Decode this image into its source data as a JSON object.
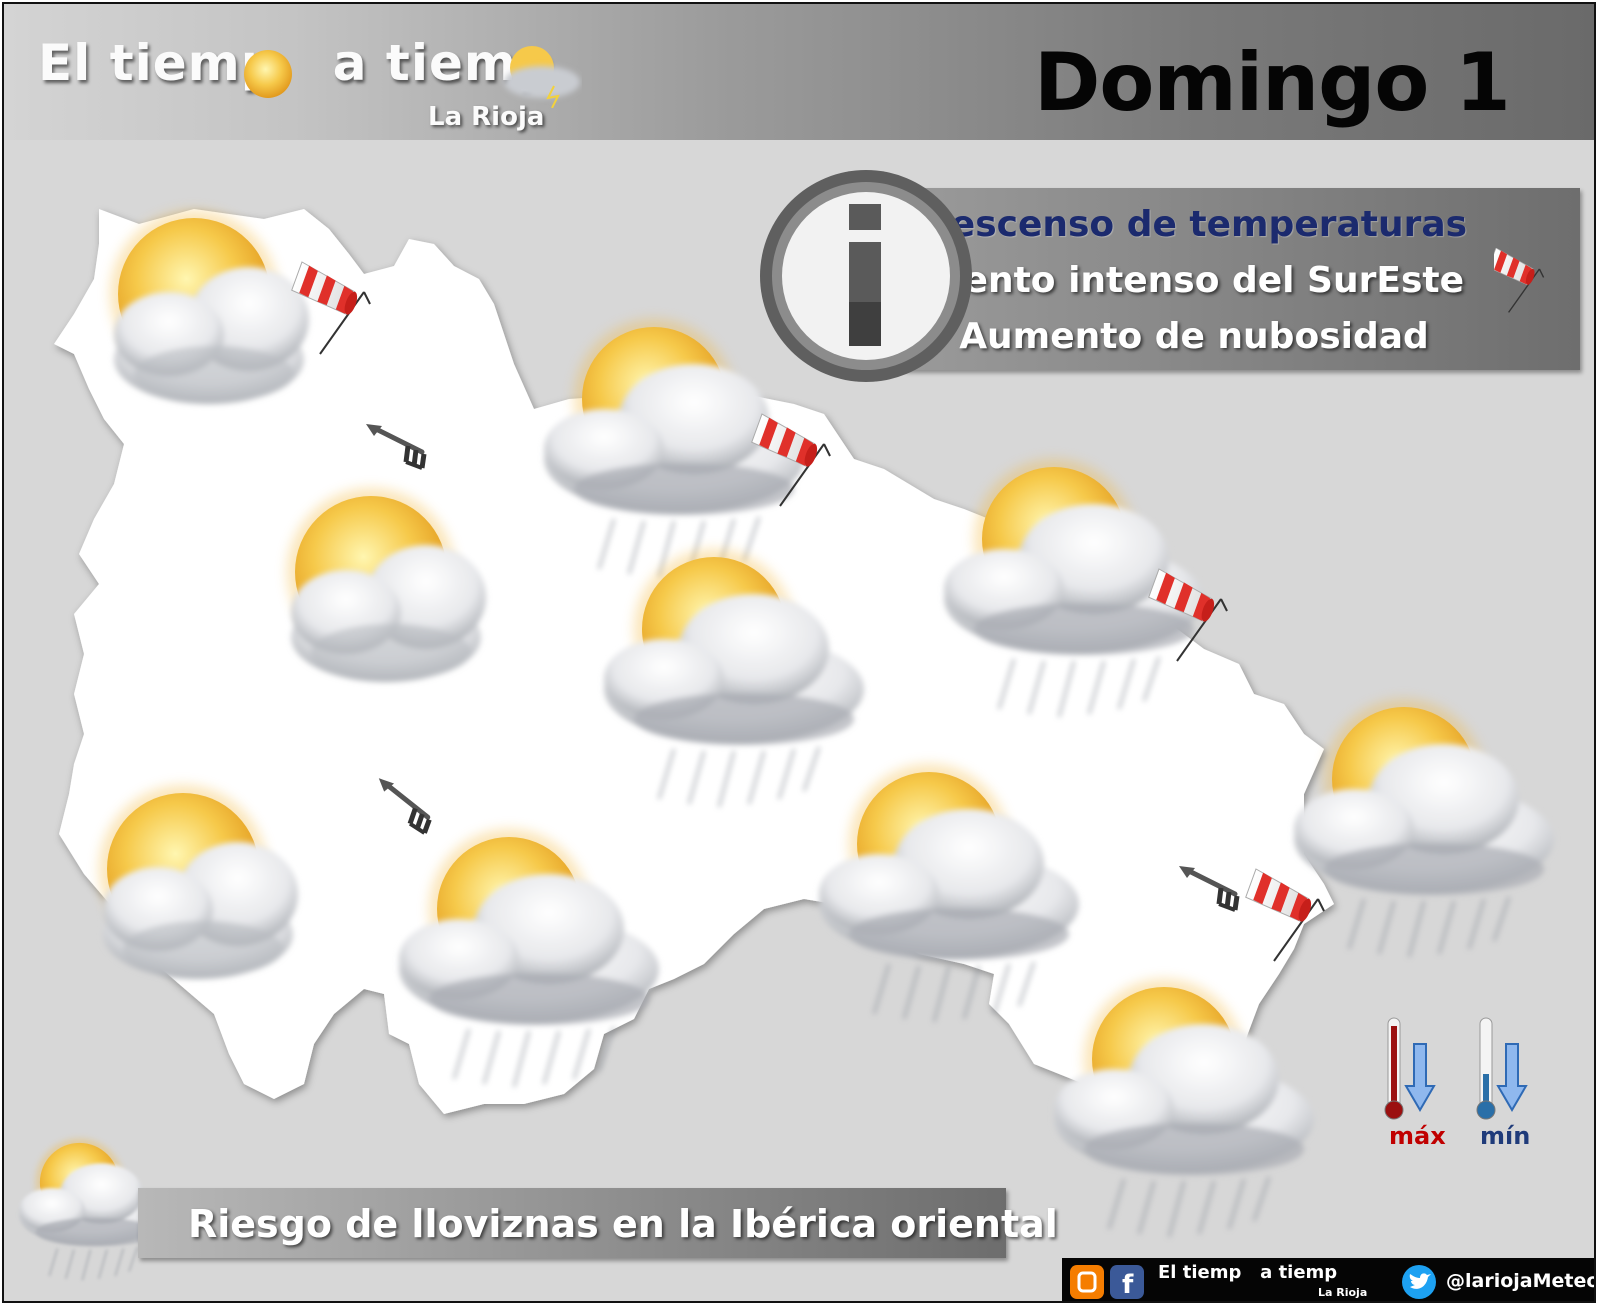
{
  "header": {
    "brand_title": "El tiemp   a tiemp",
    "brand_subtitle": "La Rioja",
    "day": "Domingo 1"
  },
  "info_panel": {
    "icon": "info-icon",
    "lines": [
      "Descenso de temperaturas",
      "Viento intenso del SurEste",
      "Aumento de nubosidad"
    ]
  },
  "map": {
    "region": "La Rioja",
    "weather_symbols": [
      "sun-cloud-icon",
      "sun-cloud-icon",
      "sun-cloud-icon",
      "sun-cloud-icon",
      "sun-cloud-icon",
      "sun-cloud-rain-icon",
      "sun-cloud-rain-icon",
      "sun-cloud-rain-icon",
      "sun-cloud-rain-icon",
      "sun-cloud-icon"
    ],
    "wind_direction": "SurEste",
    "wind_symbols": [
      "windsock-icon",
      "wind-arrow-icon"
    ]
  },
  "legend": {
    "max_label": "máx",
    "min_label": "mín",
    "max_color": "#c00000",
    "min_color": "#1f3b7a",
    "trend": "down"
  },
  "banner": {
    "text": "Riesgo de lloviznas en la Ibérica oriental"
  },
  "footer": {
    "brand": "El tiemp   a tiemp",
    "brand_sub": "La Rioja",
    "handle": "@lariojaMeteo",
    "icons": [
      "blogger-icon",
      "facebook-icon",
      "twitter-icon"
    ]
  },
  "colors": {
    "background": "#d7d7d7",
    "map_fill": "#ffffff",
    "info_title": "#1b2a6e",
    "footer_bg": "#050505"
  }
}
